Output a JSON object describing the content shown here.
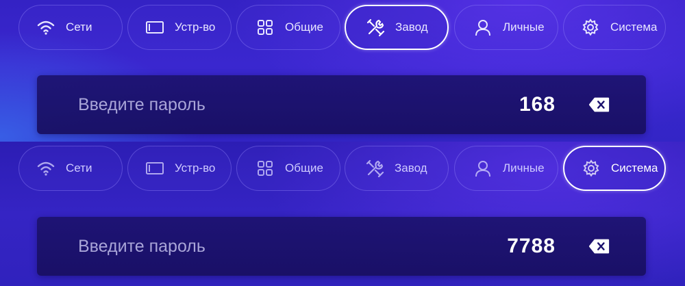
{
  "colors": {
    "accent": "#ffffff",
    "background": "#3422c4",
    "field_bg": "#1c126e"
  },
  "screens": [
    {
      "tabs": [
        {
          "label": "Сети",
          "icon": "wifi-icon",
          "active": false
        },
        {
          "label": "Устр-во",
          "icon": "display-icon",
          "active": false
        },
        {
          "label": "Общие",
          "icon": "grid-icon",
          "active": false
        },
        {
          "label": "Завод",
          "icon": "tools-icon",
          "active": true
        },
        {
          "label": "Личные",
          "icon": "user-icon",
          "active": false
        },
        {
          "label": "Система",
          "icon": "gear-icon",
          "active": false
        }
      ],
      "password": {
        "placeholder": "Введите пароль",
        "value": "168",
        "backspace_icon": "backspace-icon"
      }
    },
    {
      "tabs": [
        {
          "label": "Сети",
          "icon": "wifi-icon",
          "active": false
        },
        {
          "label": "Устр-во",
          "icon": "display-icon",
          "active": false
        },
        {
          "label": "Общие",
          "icon": "grid-icon",
          "active": false
        },
        {
          "label": "Завод",
          "icon": "tools-icon",
          "active": false
        },
        {
          "label": "Личные",
          "icon": "user-icon",
          "active": false
        },
        {
          "label": "Система",
          "icon": "gear-icon",
          "active": true
        }
      ],
      "password": {
        "placeholder": "Введите пароль",
        "value": "7788",
        "backspace_icon": "backspace-icon"
      }
    }
  ]
}
